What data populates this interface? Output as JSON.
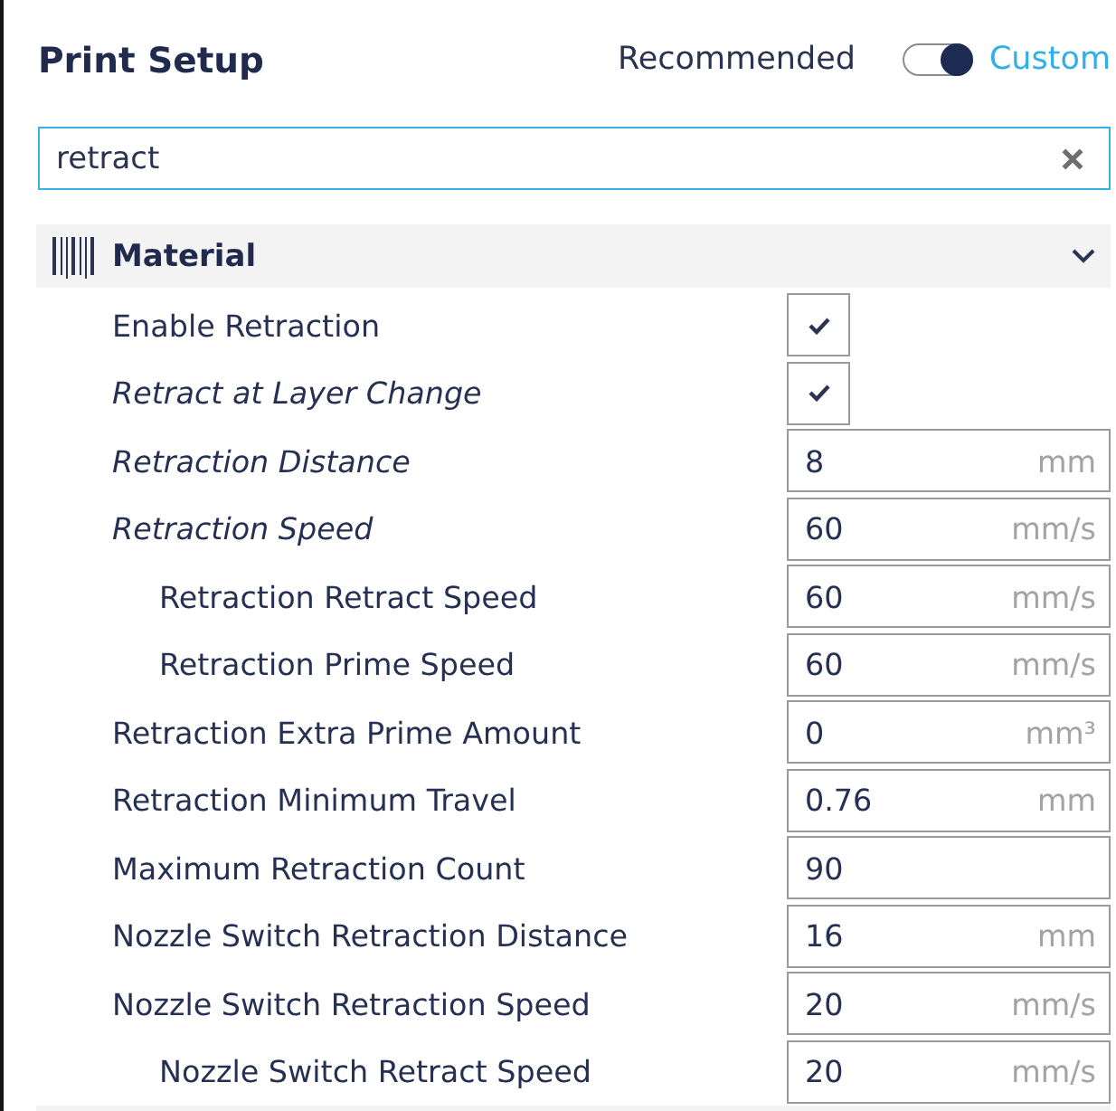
{
  "panel": {
    "title": "Print Setup",
    "mode_switch": {
      "left_label": "Recommended",
      "right_label": "Custom",
      "on": true
    }
  },
  "search": {
    "value": "retract"
  },
  "categories": [
    {
      "title": "Material",
      "expanded": true,
      "settings": [
        {
          "label": "Enable Retraction",
          "user_modified": false,
          "kind": "checkbox",
          "checked": true
        },
        {
          "label": "Retract at Layer Change",
          "user_modified": true,
          "kind": "checkbox",
          "checked": true
        },
        {
          "label": "Retraction Distance",
          "user_modified": true,
          "kind": "number",
          "value": "8",
          "unit": "mm"
        },
        {
          "label": "Retraction Speed",
          "user_modified": true,
          "kind": "number",
          "value": "60",
          "unit": "mm/s",
          "children": [
            {
              "label": "Retraction Retract Speed",
              "user_modified": false,
              "kind": "number",
              "value": "60",
              "unit": "mm/s"
            },
            {
              "label": "Retraction Prime Speed",
              "user_modified": false,
              "kind": "number",
              "value": "60",
              "unit": "mm/s"
            }
          ]
        },
        {
          "label": "Retraction Extra Prime Amount",
          "user_modified": false,
          "kind": "number",
          "value": "0",
          "unit": "mm³"
        },
        {
          "label": "Retraction Minimum Travel",
          "user_modified": false,
          "kind": "number",
          "value": "0.76",
          "unit": "mm"
        },
        {
          "label": "Maximum Retraction Count",
          "user_modified": false,
          "kind": "number",
          "value": "90"
        },
        {
          "label": "Nozzle Switch Retraction Distance",
          "user_modified": false,
          "kind": "number",
          "value": "16",
          "unit": "mm"
        },
        {
          "label": "Nozzle Switch Retraction Speed",
          "user_modified": false,
          "kind": "number",
          "value": "20",
          "unit": "mm/s",
          "children": [
            {
              "label": "Nozzle Switch Retract Speed",
              "user_modified": false,
              "kind": "number",
              "value": "20",
              "unit": "mm/s"
            }
          ]
        }
      ]
    }
  ]
}
